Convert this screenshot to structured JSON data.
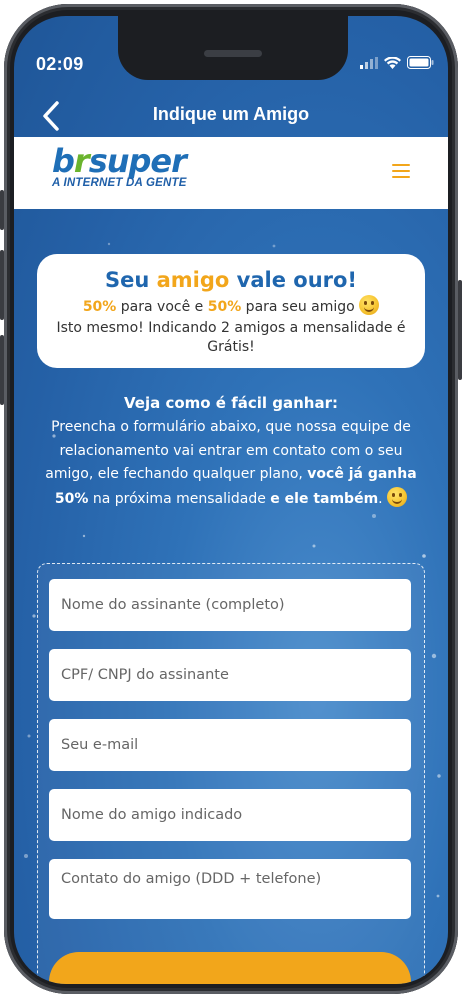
{
  "status_bar": {
    "time": "02:09",
    "icons": [
      "signal-icon",
      "wifi-icon",
      "battery-icon"
    ]
  },
  "nav": {
    "title": "Indique um Amigo",
    "back_icon": "chevron-left-icon"
  },
  "brand": {
    "logo_prefix": "b",
    "logo_r": "r",
    "logo_suffix": "super",
    "tagline": "A INTERNET DA GENTE",
    "menu_icon": "hamburger-menu-icon"
  },
  "promo_card": {
    "title_part1": "Seu ",
    "title_highlight": "amigo",
    "title_part2": " vale ouro!",
    "percent_you": "50%",
    "text_for_you": " para você e ",
    "percent_friend": "50%",
    "text_for_friend": " para seu amigo ",
    "description": "Isto mesmo! Indicando 2 amigos a mensalidade é Grátis!"
  },
  "how_to": {
    "title": "Veja como é fácil ganhar:",
    "text_part1": "Preencha o formulário abaixo, que nossa equipe de relacionamento vai entrar em contato com o seu amigo, ele fechando qualquer plano, ",
    "text_bold1": "você já ganha 50%",
    "text_part2": " na próxima mensalidade ",
    "text_bold2": "e ele também",
    "text_part3": ". "
  },
  "form": {
    "fields": [
      {
        "placeholder": "Nome do assinante (completo)"
      },
      {
        "placeholder": "CPF/ CNPJ do assinante"
      },
      {
        "placeholder": "Seu e-mail"
      },
      {
        "placeholder": "Nome do amigo indicado"
      },
      {
        "placeholder": "Contato do amigo (DDD + telefone)"
      }
    ],
    "submit_label": ""
  },
  "colors": {
    "primary_blue": "#1f66ae",
    "accent_gold": "#f2a61b",
    "logo_green": "#6ab42d",
    "background_blue": "#2561a7"
  }
}
